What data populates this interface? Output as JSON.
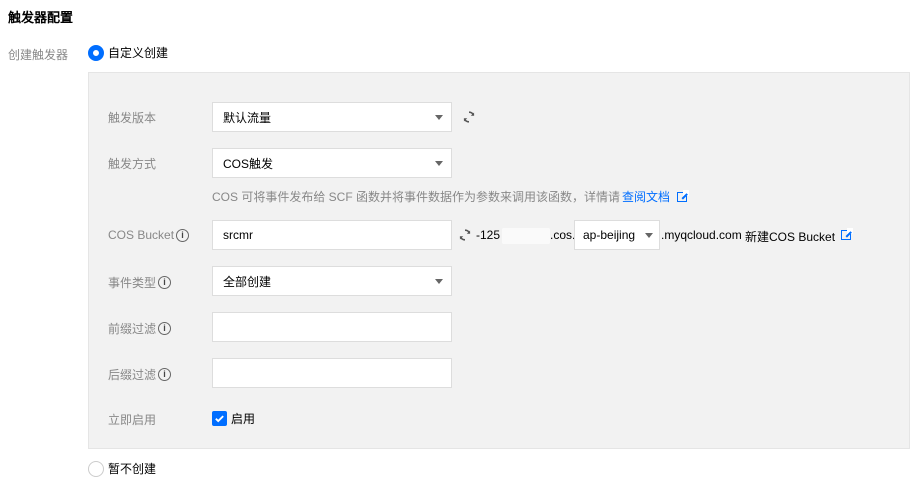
{
  "section_title": "触发器配置",
  "create_trigger_label": "创建触发器",
  "radio_custom": "自定义创建",
  "radio_none": "暂不创建",
  "form": {
    "version": {
      "label": "触发版本",
      "value": "默认流量"
    },
    "method": {
      "label": "触发方式",
      "value": "COS触发"
    },
    "help": {
      "text": "COS 可将事件发布给 SCF 函数并将事件数据作为参数来调用该函数，详情请",
      "link": "查阅文档"
    },
    "bucket": {
      "label": "COS Bucket",
      "value": "srcmr",
      "prefix": "-125",
      "cos": ".cos.",
      "region": "ap-beijing",
      "suffix": ".myqcloud.com",
      "new_link": "新建COS Bucket"
    },
    "event_type": {
      "label": "事件类型",
      "value": "全部创建"
    },
    "prefix_filter": {
      "label": "前缀过滤",
      "value": ""
    },
    "suffix_filter": {
      "label": "后缀过滤",
      "value": ""
    },
    "enable": {
      "label": "立即启用",
      "checkbox_label": "启用",
      "checked": true
    }
  },
  "colors": {
    "accent": "#006eff",
    "panel_bg": "#f2f2f2",
    "label": "#888888"
  },
  "icons": [
    "refresh-icon",
    "info-icon",
    "external-link-icon",
    "caret-down-icon",
    "check-icon"
  ]
}
